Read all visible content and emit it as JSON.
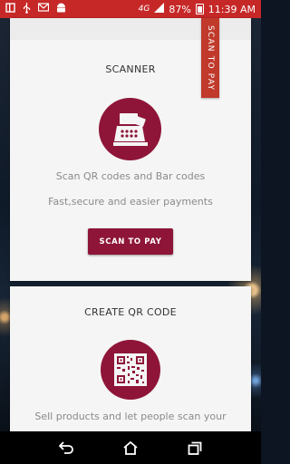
{
  "status_bar": {
    "battery": "87%",
    "time": "11:39 AM",
    "network": "4G",
    "icons": [
      "tablet-icon",
      "usb-icon",
      "notification-icon",
      "android-icon",
      "signal-icon",
      "battery-icon"
    ]
  },
  "side_tab": {
    "label": "SCAN TO PAY"
  },
  "scanner_card": {
    "title": "SCANNER",
    "line1": "Scan QR codes and Bar codes",
    "line2": "Fast,secure and easier payments",
    "button": "SCAN TO PAY",
    "icon": "cash-register-icon"
  },
  "qr_card": {
    "title": "CREATE QR CODE",
    "line1": "Sell products and let people scan your",
    "icon": "qr-code-icon"
  },
  "nav_bar": {
    "icons": [
      "back-icon",
      "home-icon",
      "recents-icon"
    ]
  },
  "colors": {
    "status_bar": "#c62828",
    "accent": "#8e1538",
    "side_tab": "#c0392b",
    "card": "#f5f5f5"
  }
}
